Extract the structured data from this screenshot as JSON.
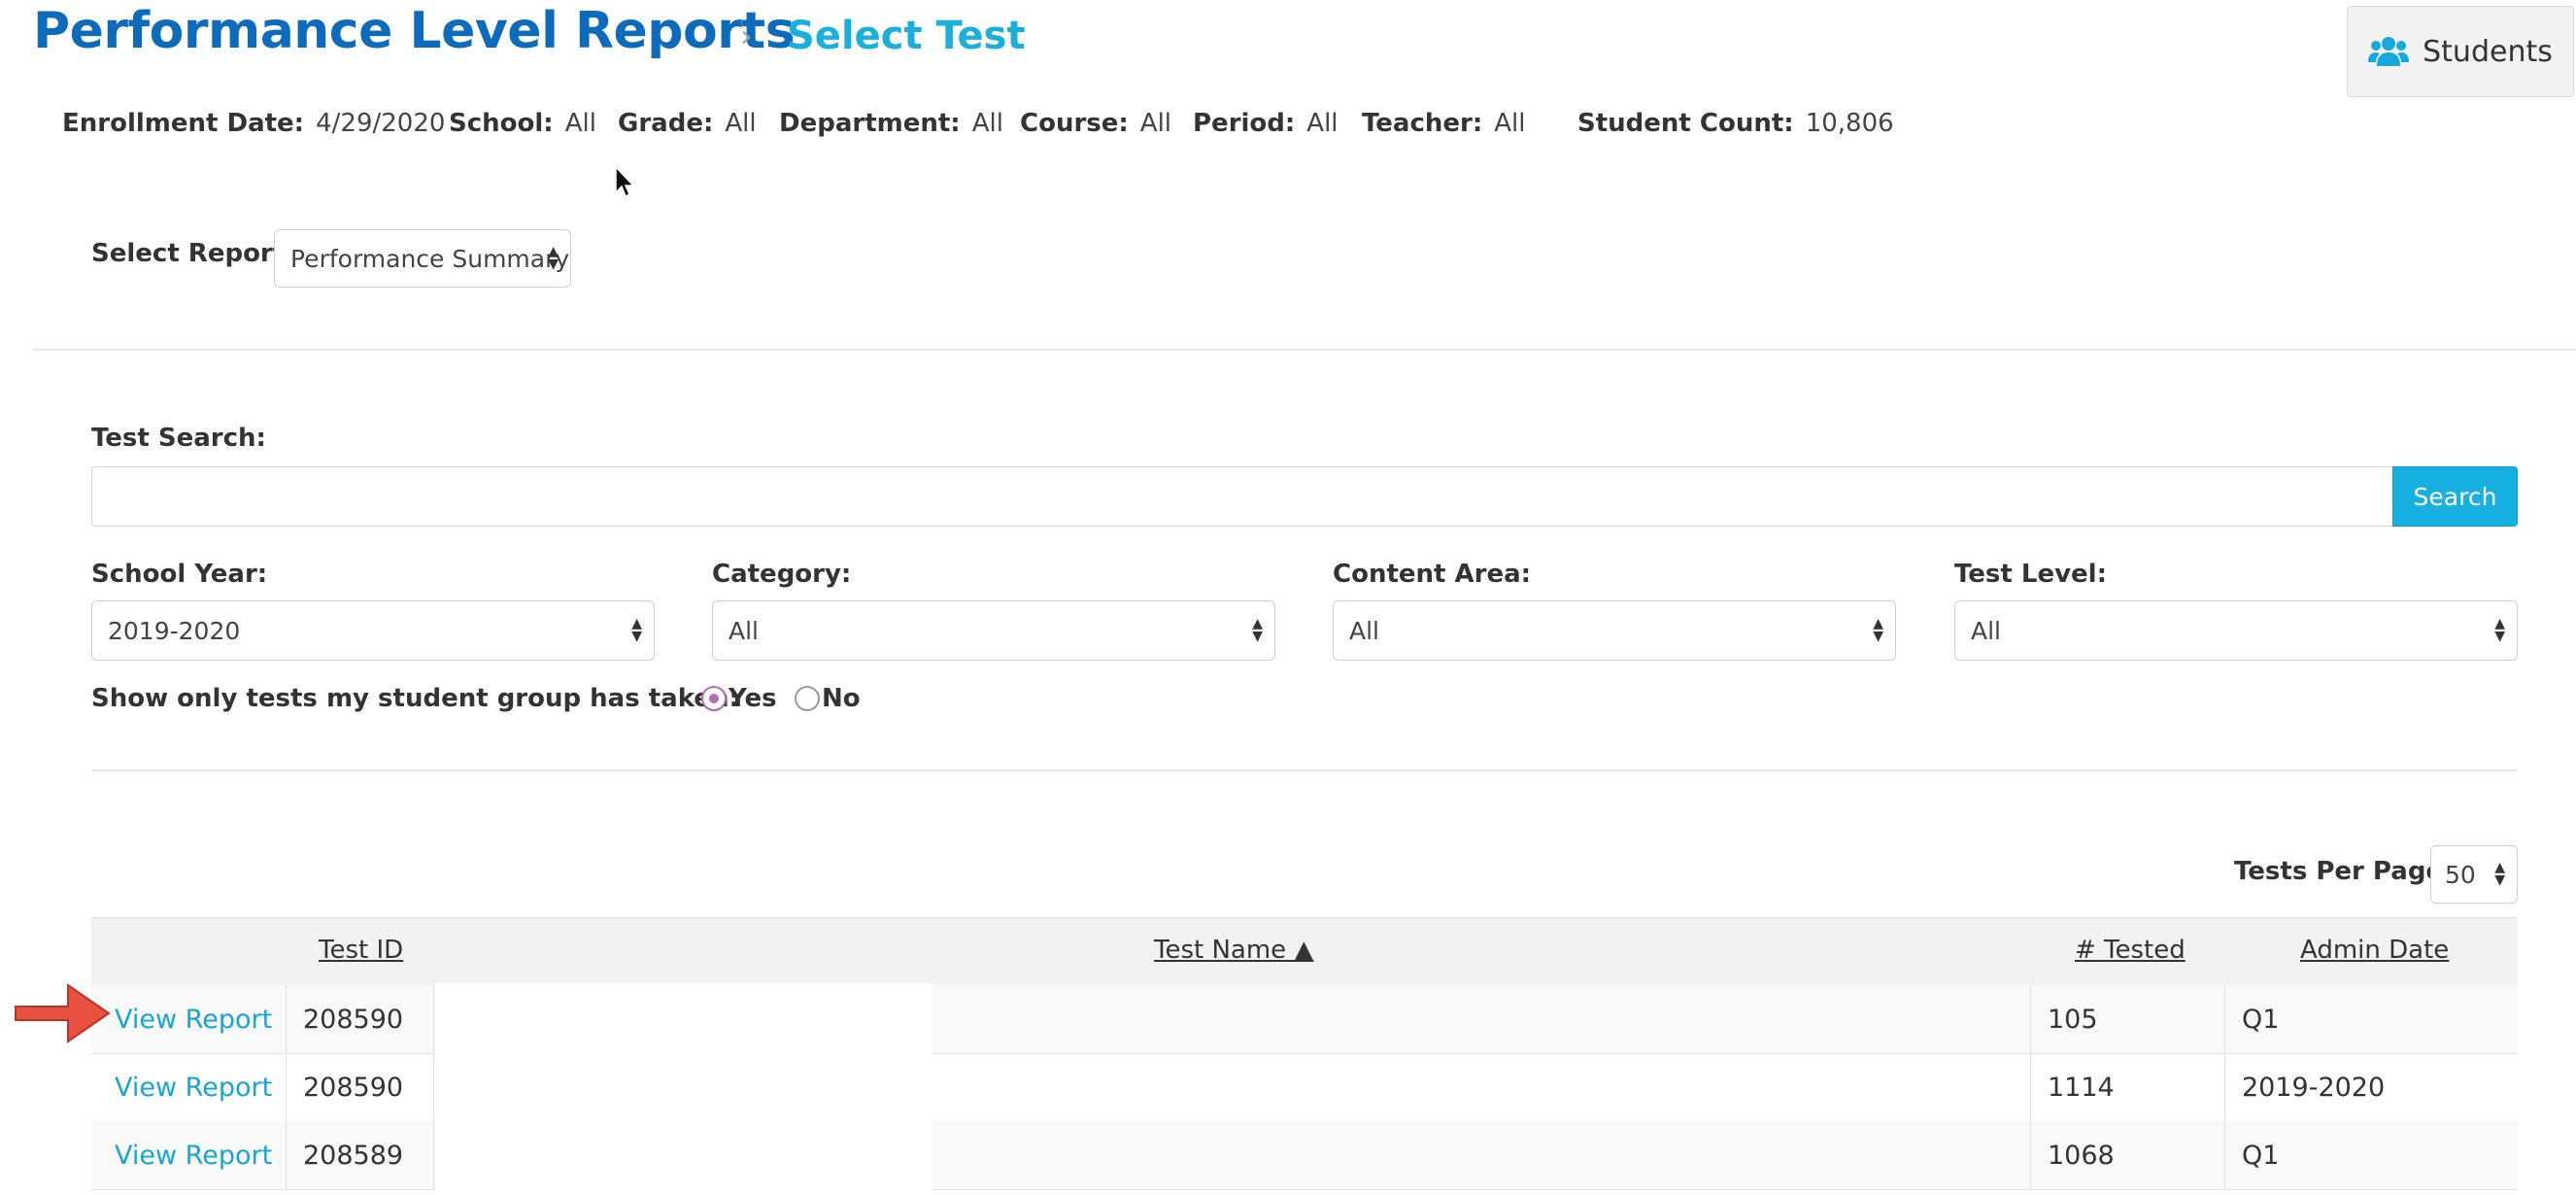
{
  "header": {
    "title": "Performance Level Reports",
    "separator": "›",
    "current": "Select Test",
    "students_label": "Students"
  },
  "filters": [
    {
      "label": "Enrollment Date:",
      "value": "4/29/2020"
    },
    {
      "label": "School:",
      "value": "All"
    },
    {
      "label": "Grade:",
      "value": "All"
    },
    {
      "label": "Department:",
      "value": "All"
    },
    {
      "label": "Course:",
      "value": "All"
    },
    {
      "label": "Period:",
      "value": "All"
    },
    {
      "label": "Teacher:",
      "value": "All"
    },
    {
      "label": "Student Count:",
      "value": "10,806"
    }
  ],
  "report": {
    "label": "Select Report:",
    "selected": "Performance Summary"
  },
  "search": {
    "label": "Test Search:",
    "value": "",
    "placeholder": "",
    "button_label": "Search"
  },
  "dropdowns": [
    {
      "label": "School Year:",
      "selected": "2019-2020"
    },
    {
      "label": "Category:",
      "selected": "All"
    },
    {
      "label": "Content Area:",
      "selected": "All"
    },
    {
      "label": "Test Level:",
      "selected": "All"
    }
  ],
  "group_filter": {
    "label": "Show only tests my student group has taken:",
    "yes_label": "Yes",
    "no_label": "No",
    "selected": "Yes"
  },
  "paging": {
    "label": "Tests Per Page:",
    "selected": "50"
  },
  "table": {
    "columns": [
      "Test ID",
      "Test Name ▲",
      "# Tested",
      "Admin Date"
    ],
    "rows": [
      {
        "action": "View Report",
        "test_id": "208590",
        "test_name": "",
        "tested": "105",
        "admin_date": "Q1"
      },
      {
        "action": "View Report",
        "test_id": "208590",
        "test_name": "",
        "tested": "1114",
        "admin_date": "2019-2020"
      },
      {
        "action": "View Report",
        "test_id": "208589",
        "test_name": "",
        "tested": "1068",
        "admin_date": "Q1"
      }
    ]
  },
  "colors": {
    "title": "#0d6bbd",
    "crumb": "#1ab0dc",
    "link": "#16a6d6",
    "search_button": "#16b1e0",
    "radio": "#b46bb6",
    "pointer_arrow": "#e8503f"
  }
}
